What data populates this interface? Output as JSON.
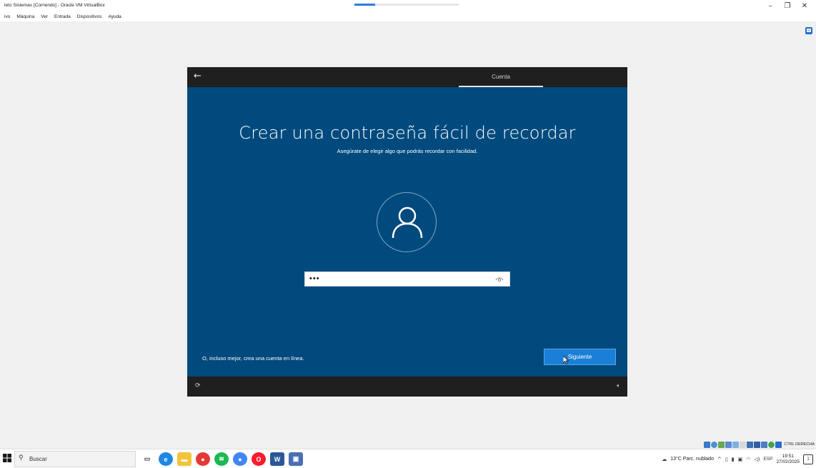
{
  "host": {
    "window_title": "leto Sistemas [Corriendo] - Oracle VM VirtualBox",
    "menu": [
      "ivo",
      "Máquina",
      "Ver",
      "Entrada",
      "Dispositivos",
      "Ayuda"
    ],
    "controls": {
      "minimize": "–",
      "maximize": "❐",
      "close": "✕"
    },
    "progress": 0.2,
    "statusbar_label": "CTRL DERECHA",
    "accent_color": "#2a7de1"
  },
  "vm": {
    "tab_label": "Cuenta",
    "title": "Crear una contraseña fácil de recordar",
    "subtitle": "Asegúrate de elegir algo que podrás recordar con facilidad.",
    "password_value": "•••",
    "online_link": "O, incluso mejor, crea una cuenta en línea.",
    "next_button": "Siguiente",
    "colors": {
      "background": "#014a7e",
      "button": "#1a7fd6",
      "bars": "#1f1f1f"
    },
    "icons": {
      "back": "back-arrow-icon",
      "user": "user-icon",
      "reveal": "eye-icon",
      "power": "power-icon",
      "volume": "volume-icon"
    }
  },
  "taskbar": {
    "search_placeholder": "Buscar",
    "weather": "13°C  Parc. nublado",
    "lang": "ESP",
    "time": "19:51",
    "date": "27/02/2025"
  }
}
